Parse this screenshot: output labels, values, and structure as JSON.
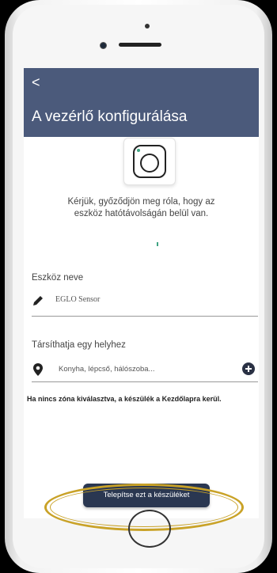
{
  "header": {
    "back_symbol": "<",
    "title": "A vezérlő konfigurálása"
  },
  "device": {
    "icon": "camera-icon",
    "check_message_line1": "Kérjük, győződjön meg róla, hogy az",
    "check_message_line2": "eszköz hatótávolságán belül van."
  },
  "name_section": {
    "label": "Eszköz neve",
    "icon": "pencil-icon",
    "value": "EGLO Sensor"
  },
  "location_section": {
    "label": "Társíthatja egy helyhez",
    "icon": "location-pin-icon",
    "placeholder": "Konyha, lépcső, hálószoba...",
    "add_icon": "plus-icon",
    "note": "Ha nincs zóna kiválasztva, a készülék a Kezdőlapra kerül."
  },
  "actions": {
    "install_label": "Telepítse ezt a készüléket"
  },
  "colors": {
    "header": "#4b5a7b",
    "button": "#2a3751",
    "highlight": "#c9a227",
    "accent": "#3fa382"
  }
}
